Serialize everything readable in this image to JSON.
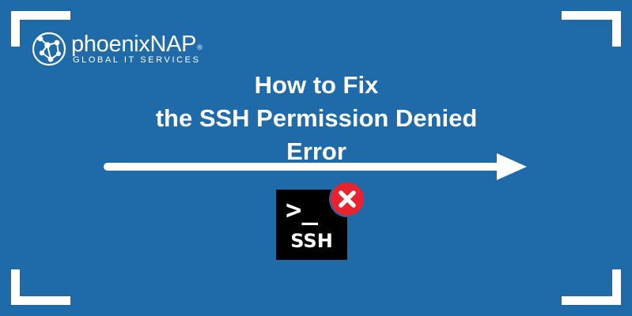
{
  "brand": {
    "name": "phoenixNAP",
    "registered_mark": "®",
    "tagline": "GLOBAL IT SERVICES",
    "logo_icon": "globe-network-icon"
  },
  "headline": {
    "line1": "How to Fix",
    "line2": "the SSH Permission Denied",
    "line3": "Error"
  },
  "ssh_icon": {
    "prompt": ">_",
    "label": "SSH",
    "badge_icon": "error-x-icon"
  },
  "colors": {
    "background": "#1f6aa8",
    "foreground": "#ffffff",
    "icon_background": "#000000",
    "error_red": "#e8232f"
  }
}
